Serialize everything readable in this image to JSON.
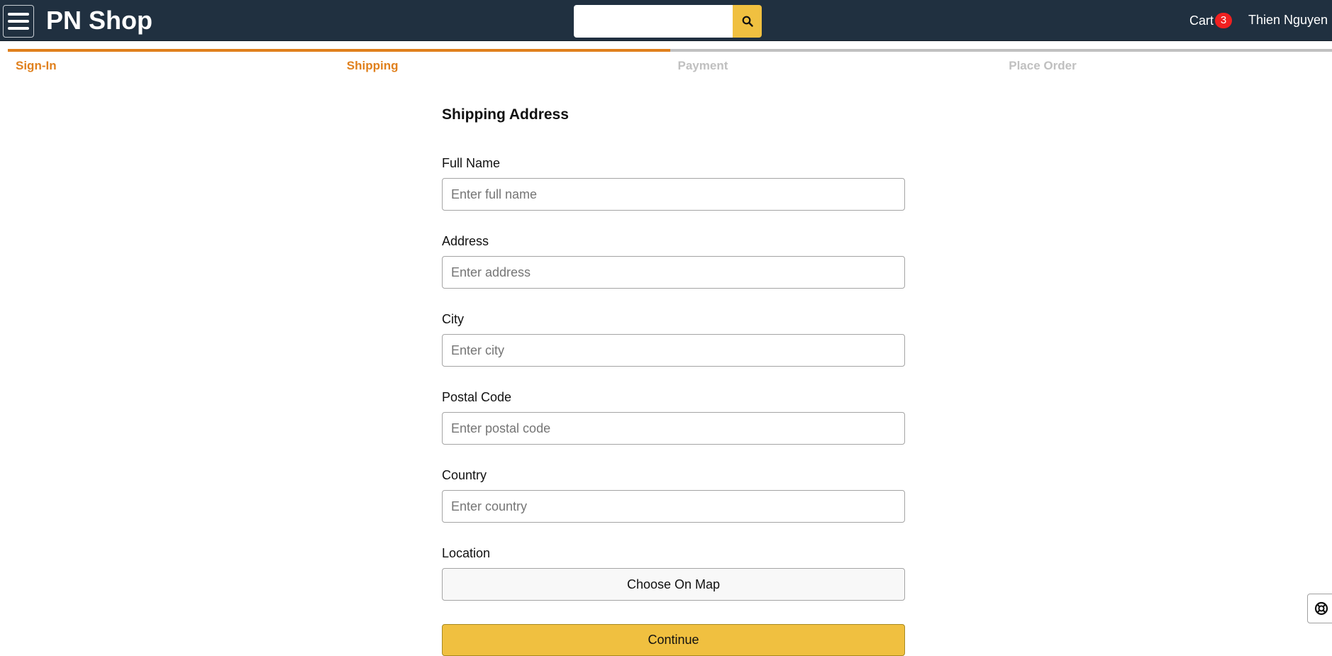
{
  "header": {
    "brand": "PN Shop",
    "search": {
      "placeholder": "",
      "value": ""
    },
    "cart": {
      "label": "Cart",
      "count": "3"
    },
    "user": "Thien Nguyen",
    "colors": {
      "background": "#203040",
      "accent": "#f0c040",
      "badge": "#f02020"
    }
  },
  "checkout_steps": [
    {
      "label": "Sign-In",
      "active": true
    },
    {
      "label": "Shipping",
      "active": true
    },
    {
      "label": "Payment",
      "active": false
    },
    {
      "label": "Place Order",
      "active": false
    }
  ],
  "form": {
    "title": "Shipping Address",
    "fields": [
      {
        "label": "Full Name",
        "placeholder": "Enter full name",
        "value": ""
      },
      {
        "label": "Address",
        "placeholder": "Enter address",
        "value": ""
      },
      {
        "label": "City",
        "placeholder": "Enter city",
        "value": ""
      },
      {
        "label": "Postal Code",
        "placeholder": "Enter postal code",
        "value": ""
      },
      {
        "label": "Country",
        "placeholder": "Enter country",
        "value": ""
      }
    ],
    "location": {
      "label": "Location",
      "button": "Choose On Map"
    },
    "continue_button": "Continue"
  },
  "icons": {
    "menu": "hamburger-menu-icon",
    "search": "search-icon",
    "help": "lifebuoy-icon"
  }
}
